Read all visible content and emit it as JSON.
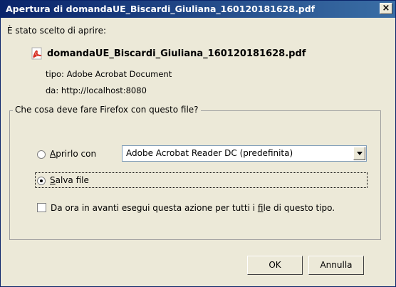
{
  "window": {
    "title": "Apertura di domandaUE_Biscardi_Giuliana_160120181628.pdf",
    "close_glyph": "×"
  },
  "intro_text": "È stato scelto di aprire:",
  "file": {
    "icon": "pdf-file-icon",
    "name": "domandaUE_Biscardi_Giuliana_160120181628.pdf",
    "type_label": "tipo:",
    "type_value": "Adobe Acrobat Document",
    "from_label": "da:",
    "from_value": "http://localhost:8080"
  },
  "action": {
    "legend": "Che cosa deve fare Firefox con questo file?",
    "open_with": {
      "mnemonic": "A",
      "label_rest": "prirlo con",
      "selected": false,
      "app": "Adobe Acrobat Reader DC  (predefinita)"
    },
    "save_file": {
      "mnemonic": "S",
      "label_rest": "alva file",
      "selected": true
    },
    "always": {
      "label_before": "Da ora in avanti esegui questa azione per tutti i ",
      "mnemonic": "f",
      "label_after": "ile di questo tipo.",
      "checked": false
    }
  },
  "buttons": {
    "ok": "OK",
    "cancel": "Annulla"
  }
}
